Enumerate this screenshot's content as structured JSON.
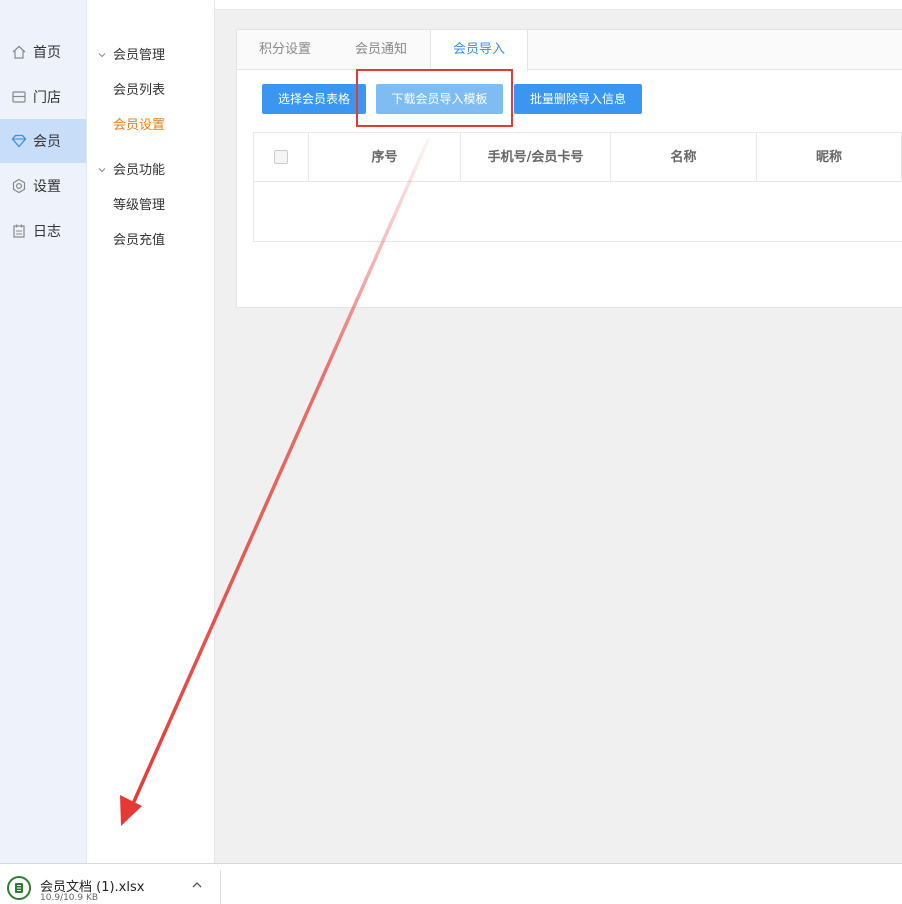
{
  "nav": {
    "items": [
      {
        "label": "首页",
        "icon": "home-icon"
      },
      {
        "label": "门店",
        "icon": "store-icon"
      },
      {
        "label": "会员",
        "icon": "diamond-icon"
      },
      {
        "label": "设置",
        "icon": "gear-icon"
      },
      {
        "label": "日志",
        "icon": "calendar-icon"
      }
    ],
    "active_label": "会员"
  },
  "subnav": {
    "groups": [
      {
        "label": "会员管理",
        "items": [
          "会员列表",
          "会员设置"
        ]
      },
      {
        "label": "会员功能",
        "items": [
          "等级管理",
          "会员充值"
        ]
      }
    ],
    "active_item": "会员设置"
  },
  "tabs": [
    "积分设置",
    "会员通知",
    "会员导入"
  ],
  "active_tab": "会员导入",
  "buttons": {
    "select_table": "选择会员表格",
    "download_template": "下载会员导入模板",
    "batch_delete": "批量删除导入信息"
  },
  "table": {
    "headers": [
      "序号",
      "手机号/会员卡号",
      "名称",
      "昵称"
    ]
  },
  "download": {
    "filename": "会员文档 (1).xlsx",
    "size": "10.9/10.9 KB"
  },
  "colors": {
    "accent": "#3a96f0",
    "active_orange": "#f07d1e",
    "annotation_red": "#e53935"
  }
}
